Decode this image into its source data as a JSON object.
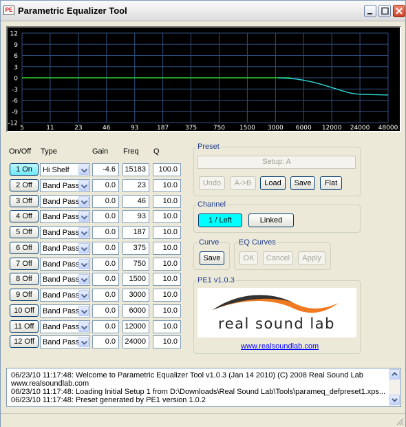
{
  "window": {
    "title": "Parametric Equalizer Tool",
    "icon_label": "PE",
    "buttons": [
      "minimize",
      "maximize",
      "close"
    ]
  },
  "graph": {
    "y_ticks": [
      "12",
      "9",
      "6",
      "3",
      "0",
      "-3",
      "-6",
      "-9",
      "-12"
    ],
    "x_ticks": [
      "5",
      "11",
      "23",
      "46",
      "93",
      "187",
      "375",
      "750",
      "1500",
      "3000",
      "6000",
      "12000",
      "24000",
      "48000"
    ],
    "colors": {
      "background": "#000000",
      "grid": "#2f4f7f",
      "flat_line": "#2bd42b",
      "curve_line": "#2ad6cf"
    }
  },
  "bands": {
    "headers": {
      "onoff": "On/Off",
      "type": "Type",
      "gain": "Gain",
      "freq": "Freq",
      "q": "Q"
    },
    "rows": [
      {
        "button": "1 On",
        "on": true,
        "type": "Hi Shelf",
        "gain": "-4.6",
        "freq": "15183",
        "q": "100.0"
      },
      {
        "button": "2 Off",
        "on": false,
        "type": "Band Pass",
        "gain": "0.0",
        "freq": "23",
        "q": "10.0"
      },
      {
        "button": "3 Off",
        "on": false,
        "type": "Band Pass",
        "gain": "0.0",
        "freq": "46",
        "q": "10.0"
      },
      {
        "button": "4 Off",
        "on": false,
        "type": "Band Pass",
        "gain": "0.0",
        "freq": "93",
        "q": "10.0"
      },
      {
        "button": "5 Off",
        "on": false,
        "type": "Band Pass",
        "gain": "0.0",
        "freq": "187",
        "q": "10.0"
      },
      {
        "button": "6 Off",
        "on": false,
        "type": "Band Pass",
        "gain": "0.0",
        "freq": "375",
        "q": "10.0"
      },
      {
        "button": "7 Off",
        "on": false,
        "type": "Band Pass",
        "gain": "0.0",
        "freq": "750",
        "q": "10.0"
      },
      {
        "button": "8 Off",
        "on": false,
        "type": "Band Pass",
        "gain": "0.0",
        "freq": "1500",
        "q": "10.0"
      },
      {
        "button": "9 Off",
        "on": false,
        "type": "Band Pass",
        "gain": "0.0",
        "freq": "3000",
        "q": "10.0"
      },
      {
        "button": "10 Off",
        "on": false,
        "type": "Band Pass",
        "gain": "0.0",
        "freq": "6000",
        "q": "10.0"
      },
      {
        "button": "11 Off",
        "on": false,
        "type": "Band Pass",
        "gain": "0.0",
        "freq": "12000",
        "q": "10.0"
      },
      {
        "button": "12 Off",
        "on": false,
        "type": "Band Pass",
        "gain": "0.0",
        "freq": "24000",
        "q": "10.0"
      }
    ]
  },
  "preset": {
    "title": "Preset",
    "setup_field": "Setup: A",
    "undo": "Undo",
    "redo": "A->B",
    "load": "Load",
    "save": "Save",
    "flat": "Flat"
  },
  "channel": {
    "title": "Channel",
    "left": "1 / Left",
    "linked": "Linked"
  },
  "curve": {
    "title": "Curve",
    "save": "Save"
  },
  "eq_curves": {
    "title": "EQ Curves",
    "ok": "OK",
    "cancel": "Cancel",
    "apply": "Apply"
  },
  "about": {
    "title": "PE1 v1.0.3",
    "logo_text": "real sound lab",
    "link": "www.realsoundlab.com"
  },
  "log": {
    "lines": [
      "06/23/10 11:17:48: Welcome to Parametric Equalizer Tool v1.0.3 (Jan 14 2010) (C) 2008 Real Sound Lab",
      "www.realsoundlab.com",
      "06/23/10 11:17:48: Loading Initial Setup 1 from D:\\Downloads\\Real Sound Lab\\Tools\\parameq_defpreset1.xps...",
      "06/23/10 11:17:48: Preset generated by PE1 version 1.0.2"
    ]
  }
}
